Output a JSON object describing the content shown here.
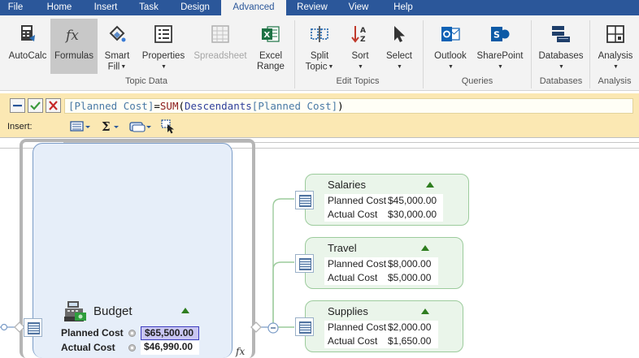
{
  "menu": {
    "file": "File",
    "home": "Home",
    "insert": "Insert",
    "task": "Task",
    "design": "Design",
    "advanced": "Advanced",
    "review": "Review",
    "view": "View",
    "help": "Help"
  },
  "ribbon": {
    "autocalc": "AutoCalc",
    "formulas": "Formulas",
    "smart_fill_1": "Smart",
    "smart_fill_2": "Fill",
    "properties": "Properties",
    "spreadsheet": "Spreadsheet",
    "excel_range_1": "Excel",
    "excel_range_2": "Range",
    "split_topic_1": "Split",
    "split_topic_2": "Topic",
    "sort": "Sort",
    "select": "Select",
    "outlook": "Outlook",
    "sharepoint": "SharePoint",
    "databases": "Databases",
    "analysis": "Analysis",
    "groups": {
      "topic_data": "Topic Data",
      "edit_topics": "Edit Topics",
      "queries": "Queries",
      "databases": "Databases",
      "analysis": "Analysis"
    }
  },
  "formula_bar": {
    "formula_ref": "[Planned Cost]",
    "formula_eq": "=",
    "formula_fn": "SUM",
    "formula_open": "(",
    "formula_fn2": "Descendants",
    "formula_arg": "[Planned Cost]",
    "formula_close": ")",
    "insert_label": "Insert:"
  },
  "map": {
    "budget": {
      "title": "Budget",
      "planned_label": "Planned Cost",
      "planned_value": "$65,500.00",
      "actual_label": "Actual Cost",
      "actual_value": "$46,990.00",
      "fx": "fx"
    },
    "topics": [
      {
        "title": "Salaries",
        "planned_label": "Planned Cost",
        "planned_value": "$45,000.00",
        "actual_label": "Actual Cost",
        "actual_value": "$30,000.00"
      },
      {
        "title": "Travel",
        "planned_label": "Planned Cost",
        "planned_value": "$8,000.00",
        "actual_label": "Actual Cost",
        "actual_value": "$5,000.00"
      },
      {
        "title": "Supplies",
        "planned_label": "Planned Cost",
        "planned_value": "$2,000.00",
        "actual_label": "Actual Cost",
        "actual_value": "$1,650.00"
      }
    ]
  },
  "colors": {
    "menu_bar": "#2b579a",
    "formula_bar": "#fbe8b3",
    "topic_fill": "#eaf5ea",
    "topic_border": "#9ccb9c",
    "budget_fill": "#e6eef9",
    "selected_value": "#c9c6f2"
  }
}
